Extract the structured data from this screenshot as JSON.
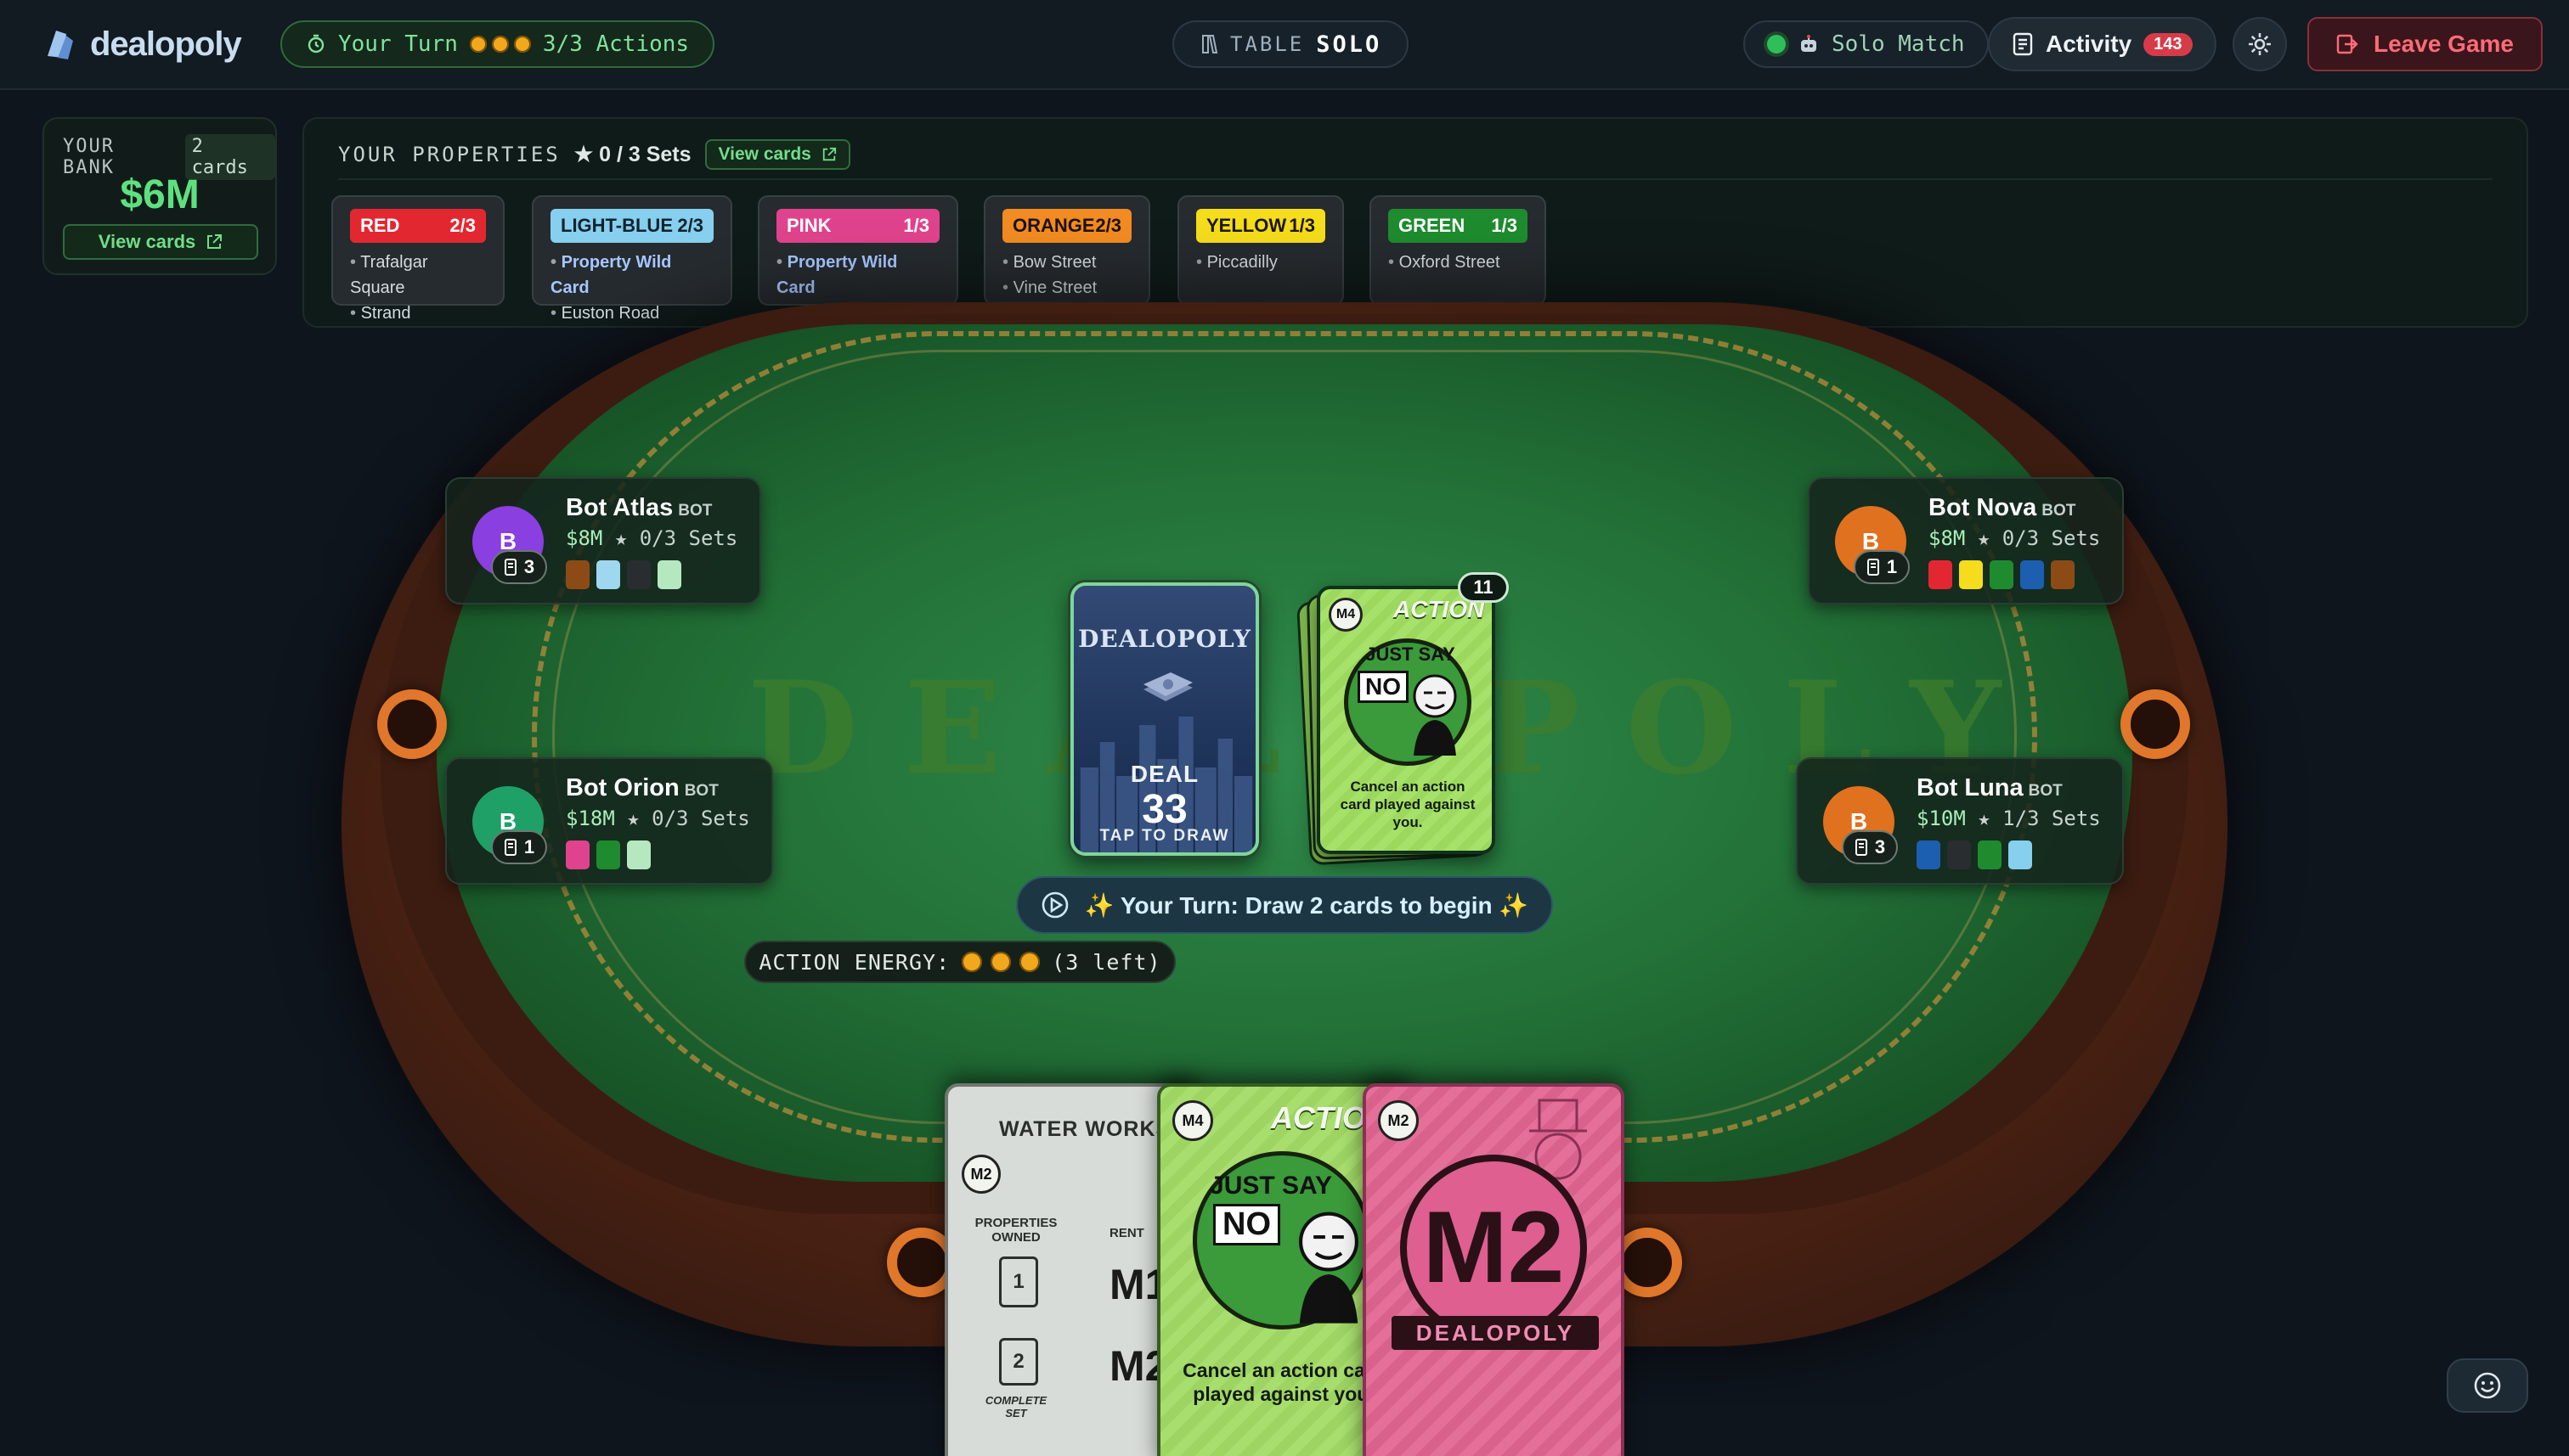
{
  "topbar": {
    "logo_text": "dealopoly",
    "turn_label": "Your Turn",
    "actions_label": "3/3 Actions",
    "table_label": "TABLE",
    "table_mode": "SOLO",
    "match_label": "Solo Match",
    "activity_label": "Activity",
    "activity_count": "143",
    "leave_label": "Leave Game"
  },
  "bank": {
    "title": "YOUR BANK",
    "cards_count": "2 cards",
    "amount": "$6M",
    "view_label": "View cards"
  },
  "properties": {
    "title": "YOUR PROPERTIES",
    "sets_label": "★ 0 / 3 Sets",
    "view_label": "View cards",
    "groups": [
      {
        "name": "RED",
        "progress": "2/3",
        "color": "#e32731",
        "text_color": "#ffffff",
        "items": [
          "Trafalgar Square",
          "Strand"
        ]
      },
      {
        "name": "LIGHT-BLUE",
        "progress": "2/3",
        "color": "#86cfee",
        "text_color": "#10222c",
        "items": [
          "Property Wild Card",
          "Euston Road"
        ]
      },
      {
        "name": "PINK",
        "progress": "1/3",
        "color": "#e0438d",
        "text_color": "#ffffff",
        "items": [
          "Property Wild Card"
        ]
      },
      {
        "name": "ORANGE",
        "progress": "2/3",
        "color": "#f28b22",
        "text_color": "#1b1206",
        "items": [
          "Bow Street",
          "Vine Street"
        ]
      },
      {
        "name": "YELLOW",
        "progress": "1/3",
        "color": "#f5dc1c",
        "text_color": "#1b1806",
        "items": [
          "Piccadilly"
        ]
      },
      {
        "name": "GREEN",
        "progress": "1/3",
        "color": "#1e8c2e",
        "text_color": "#ffffff",
        "items": [
          "Oxford Street"
        ]
      }
    ]
  },
  "players": [
    {
      "name": "Bot Atlas",
      "tag": "BOT",
      "money": "$8M",
      "sets": "★ 0/3 Sets",
      "hand": "3",
      "initial": "B",
      "avatar_color": "#8a3fe0",
      "swatches": [
        "#8c4b16",
        "#9fd6f0",
        "#2a2d30",
        "#b6e8c0"
      ]
    },
    {
      "name": "Bot Nova",
      "tag": "BOT",
      "money": "$8M",
      "sets": "★ 0/3 Sets",
      "hand": "1",
      "initial": "B",
      "avatar_color": "#e0711f",
      "swatches": [
        "#e32731",
        "#f5dc1c",
        "#1e8c2e",
        "#1c5fb0",
        "#8c4b16"
      ]
    },
    {
      "name": "Bot Orion",
      "tag": "BOT",
      "money": "$18M",
      "sets": "★ 0/3 Sets",
      "hand": "1",
      "initial": "B",
      "avatar_color": "#1fa067",
      "swatches": [
        "#e0438d",
        "#1e8c2e",
        "#b6e8c0"
      ]
    },
    {
      "name": "Bot Luna",
      "tag": "BOT",
      "money": "$10M",
      "sets": "★ 1/3 Sets",
      "hand": "3",
      "initial": "B",
      "avatar_color": "#e0711f",
      "swatches": [
        "#1c5fb0",
        "#2a2d30",
        "#1e8c2e",
        "#86cfee"
      ]
    }
  ],
  "table": {
    "watermark": "DEALOPOLY",
    "deck_brand": "DEALOPOLY",
    "deck_label": "DEAL",
    "deck_count": "33",
    "deck_tap": "TAP TO DRAW",
    "discard_count": "11",
    "discard_card": {
      "value": "M4",
      "type": "ACTION",
      "title_top": "JUST SAY",
      "title_no": "NO",
      "desc": "Cancel an action card played against you."
    },
    "prompt": "✨ Your Turn: Draw 2 cards to begin ✨",
    "energy_label": "ACTION ENERGY:",
    "energy_left": "(3 left)"
  },
  "hand": [
    {
      "kind": "utility",
      "title": "WATER WORKS",
      "value": "M2",
      "col_props": "PROPERTIES OWNED",
      "col_rent": "RENT",
      "row1_owned": "1",
      "row1_rent": "M1",
      "row2_owned": "2",
      "row2_rent": "M2",
      "complete_set": "COMPLETE SET"
    },
    {
      "kind": "action",
      "value": "M4",
      "type": "ACTION",
      "title_top": "JUST SAY",
      "title_no": "NO",
      "desc": "Cancel an action card played against you."
    },
    {
      "kind": "money",
      "value": "M2",
      "big": "M2",
      "brand": "DEALOPOLY"
    }
  ]
}
